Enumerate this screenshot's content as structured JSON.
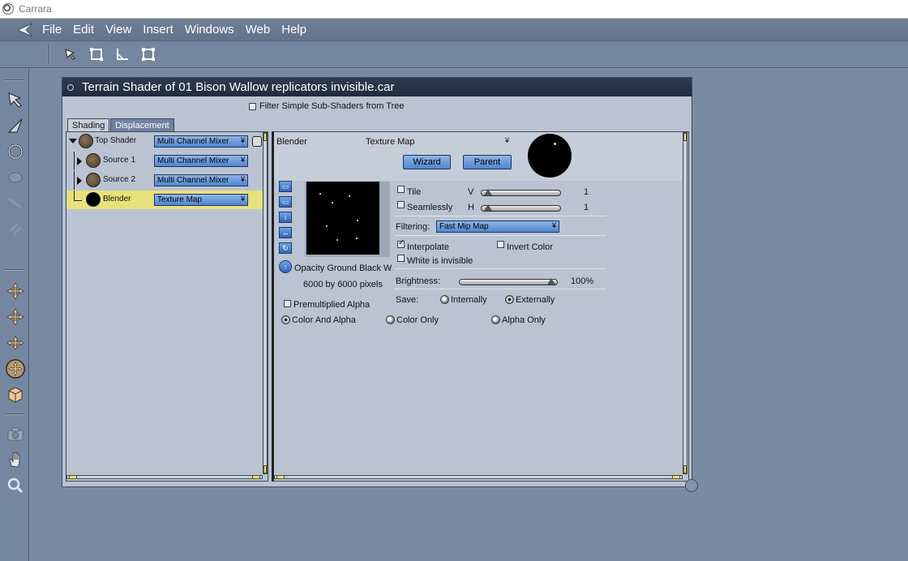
{
  "app": {
    "title": "Carrara"
  },
  "menu": [
    "File",
    "Edit",
    "View",
    "Insert",
    "Windows",
    "Web",
    "Help"
  ],
  "toolbar": {
    "tools": [
      "arrow-tool-icon",
      "rectangle-select-icon",
      "angle-tool-icon",
      "bounding-box-icon"
    ]
  },
  "left_tools": [
    "select-arrow-icon",
    "move-pointer-icon",
    "rotate-icon",
    "sphere-icon",
    "wand-icon",
    "link-icon",
    "move-plane-icon",
    "move-axes-icon",
    "move-3d-icon",
    "dolly-icon",
    "texture-cube-icon",
    "camera-icon",
    "hand-icon",
    "zoom-icon"
  ],
  "window": {
    "title": "Terrain Shader of 01 Bison Wallow replicators invisible.car",
    "filter_label": "Filter Simple Sub-Shaders from Tree",
    "tabs": {
      "shading": "Shading",
      "displacement": "Displacement"
    }
  },
  "tree": {
    "rows": [
      {
        "label": "Top Shader",
        "value": "Multi Channel Mixer"
      },
      {
        "label": "Source 1",
        "value": "Multi Channel Mixer"
      },
      {
        "label": "Source 2",
        "value": "Multi Channel Mixer"
      },
      {
        "label": "Blender",
        "value": "Texture Map"
      }
    ]
  },
  "editor": {
    "channel_label": "Blender",
    "shader_type": "Texture Map",
    "wizard_label": "Wizard",
    "parent_label": "Parent",
    "tile_label": "Tile",
    "v_label": "V",
    "v_value": "1",
    "seamlessly_label": "Seamlessly",
    "h_label": "H",
    "h_value": "1",
    "filtering_label": "Filtering:",
    "filtering_value": "Fast Mip Map",
    "interpolate_label": "Interpolate",
    "invert_label": "Invert Color",
    "white_invisible_label": "White is invisible",
    "brightness_label": "Brightness:",
    "brightness_value": "100%",
    "save_label": "Save:",
    "internally_label": "Internally",
    "externally_label": "Externally",
    "image_name": "Opacity Ground Black W",
    "image_size": "6000 by 6000 pixels",
    "premult_label": "Premultiplied Alpha",
    "color_alpha_label": "Color And Alpha",
    "color_only_label": "Color Only",
    "alpha_only_label": "Alpha Only"
  }
}
